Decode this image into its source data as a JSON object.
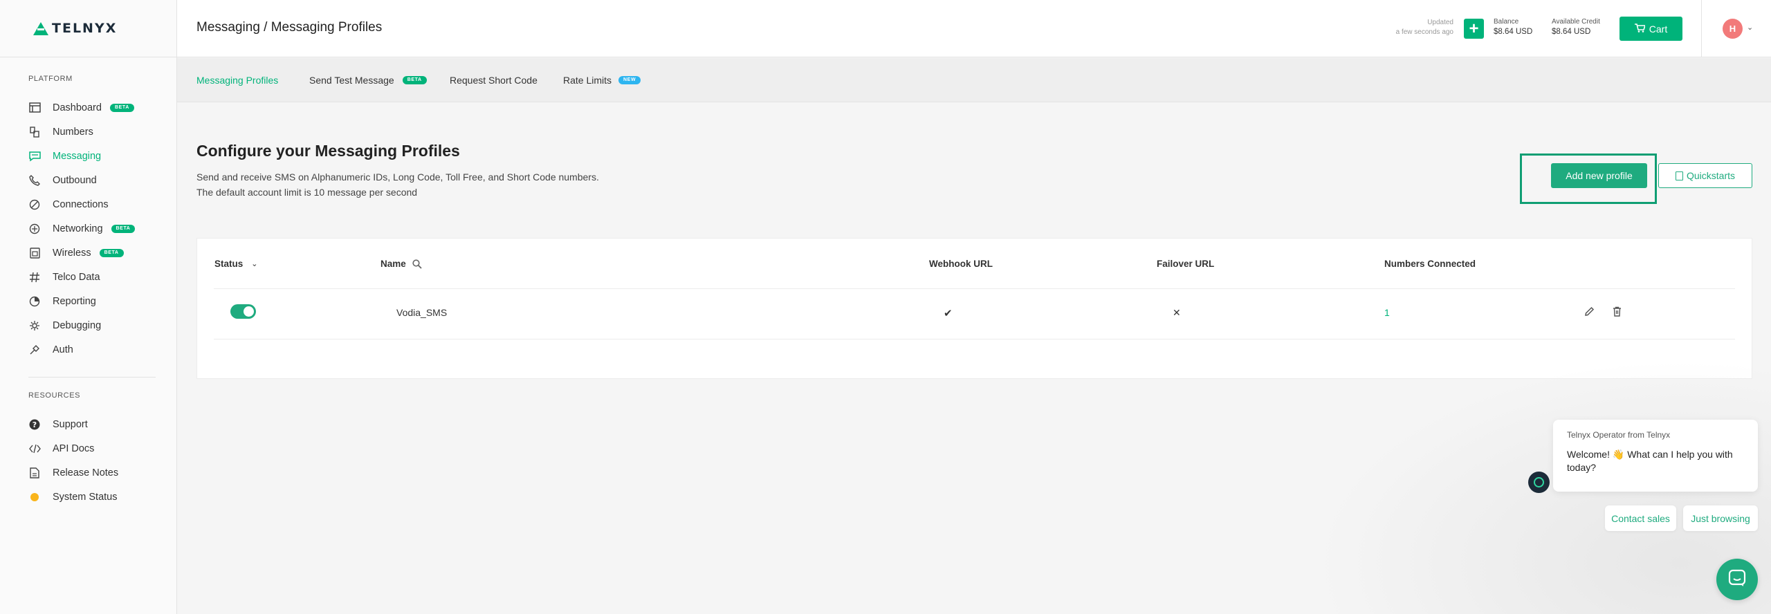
{
  "brand": {
    "logo_text": "TELNYX",
    "accent": "#00b37a"
  },
  "sidebar": {
    "platform_title": "PLATFORM",
    "items": [
      {
        "label": "Dashboard",
        "icon": "dashboard-icon",
        "badge": "BETA"
      },
      {
        "label": "Numbers",
        "icon": "numbers-icon"
      },
      {
        "label": "Messaging",
        "icon": "messaging-icon",
        "active": true
      },
      {
        "label": "Outbound",
        "icon": "phone-icon"
      },
      {
        "label": "Connections",
        "icon": "connections-icon"
      },
      {
        "label": "Networking",
        "icon": "networking-icon",
        "badge": "BETA"
      },
      {
        "label": "Wireless",
        "icon": "wireless-icon",
        "badge": "BETA"
      },
      {
        "label": "Telco Data",
        "icon": "telco-data-icon"
      },
      {
        "label": "Reporting",
        "icon": "reporting-icon"
      },
      {
        "label": "Debugging",
        "icon": "debugging-icon"
      },
      {
        "label": "Auth",
        "icon": "auth-icon"
      }
    ],
    "resources_title": "RESOURCES",
    "resources": [
      {
        "label": "Support",
        "icon": "help-icon"
      },
      {
        "label": "API Docs",
        "icon": "code-icon"
      },
      {
        "label": "Release Notes",
        "icon": "document-icon"
      },
      {
        "label": "System Status",
        "icon": "status-dot-icon"
      }
    ]
  },
  "header": {
    "title": "Messaging / Messaging Profiles",
    "updated_label": "Updated",
    "updated_time": "a few seconds ago",
    "balance_label": "Balance",
    "balance_value": "$8.64 USD",
    "credit_label": "Available Credit",
    "credit_value": "$8.64 USD",
    "cart_label": "Cart",
    "avatar_initial": "H"
  },
  "tabs": [
    {
      "label": "Messaging Profiles",
      "active": true
    },
    {
      "label": "Send Test Message",
      "badge": "BETA"
    },
    {
      "label": "Request Short Code"
    },
    {
      "label": "Rate Limits",
      "badge": "NEW"
    }
  ],
  "main": {
    "title": "Configure your Messaging Profiles",
    "desc_line1": "Send and receive SMS on Alphanumeric IDs, Long Code, Toll Free, and Short Code numbers.",
    "desc_line2": "The default account limit is 10 message per second",
    "add_button": "Add new profile",
    "quickstarts_button": "Quickstarts"
  },
  "table": {
    "headers": {
      "status": "Status",
      "name": "Name",
      "webhook": "Webhook URL",
      "failover": "Failover URL",
      "numbers": "Numbers Connected"
    },
    "rows": [
      {
        "enabled": true,
        "name": "Vodia_SMS",
        "webhook": "✔",
        "failover": "✕",
        "numbers": "1"
      }
    ]
  },
  "chat": {
    "from": "Telnyx Operator from Telnyx",
    "message": "Welcome! 👋 What can I help you with today?",
    "chip1": "Contact sales",
    "chip2": "Just browsing"
  }
}
